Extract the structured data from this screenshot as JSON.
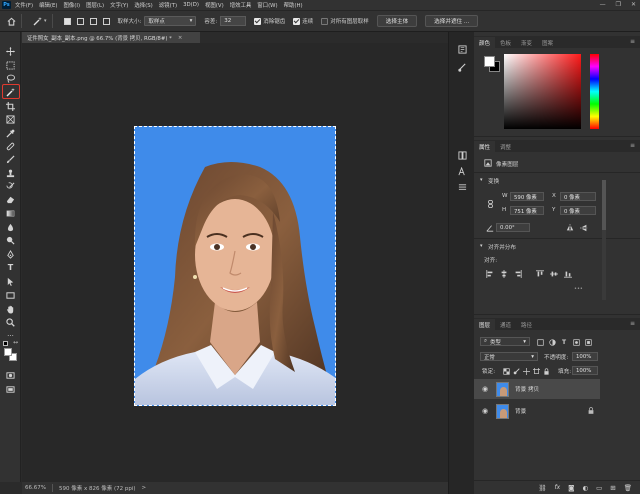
{
  "menubar": {
    "logo": "Ps",
    "items": [
      "文件(F)",
      "编辑(E)",
      "图像(I)",
      "图层(L)",
      "文字(Y)",
      "选择(S)",
      "滤镜(T)",
      "3D(D)",
      "视图(V)",
      "增效工具",
      "窗口(W)",
      "帮助(H)"
    ],
    "window_controls": [
      "—",
      "❐",
      "✕"
    ]
  },
  "options": {
    "sample_size_label": "取样大小:",
    "sample_size_value": "取样点",
    "tolerance_label": "容差:",
    "tolerance_value": "32",
    "antialias_label": "消除锯齿",
    "contiguous_label": "连续",
    "sample_all_label": "对所有图层取样",
    "select_subject": "选择主体",
    "select_mask": "选择并遮住 ..."
  },
  "document": {
    "tab_title": "证件照女_副本_副本.png @ 66.7% (背景 拷贝, RGB/8#) *",
    "tab_close": "×"
  },
  "status": {
    "zoom": "66.67%",
    "dimensions": "590 像素 x 826 像素 (72 ppi)",
    "arrow": ">"
  },
  "color_panel": {
    "tabs": [
      "颜色",
      "色板",
      "渐变",
      "图案"
    ],
    "menu": "≡"
  },
  "properties_panel": {
    "tabs": [
      "属性",
      "调整"
    ],
    "menu": "≡",
    "layer_type": "像素图层",
    "transform_title": "变换",
    "w_label": "W",
    "w_value": "590 像素",
    "x_label": "X",
    "x_value": "0 像素",
    "h_label": "H",
    "h_value": "751 像素",
    "y_label": "Y",
    "y_value": "0 像素",
    "angle_value": "0.00°",
    "align_title": "对齐并分布",
    "align_label": "对齐:",
    "more": "•••"
  },
  "layers_panel": {
    "tabs": [
      "图层",
      "通道",
      "路径"
    ],
    "menu": "≡",
    "filter_value": "类型",
    "blend_mode": "正常",
    "opacity_label": "不透明度:",
    "opacity_value": "100%",
    "lock_label": "锁定:",
    "fill_label": "填充:",
    "fill_value": "100%",
    "layers": [
      {
        "name": "背景 拷贝",
        "selected": true
      },
      {
        "name": "背景",
        "selected": false
      }
    ],
    "footer_icons": [
      "link-icon",
      "fx-icon",
      "mask-icon",
      "adjustment-icon",
      "folder-icon",
      "new-layer-icon",
      "trash-icon"
    ]
  }
}
